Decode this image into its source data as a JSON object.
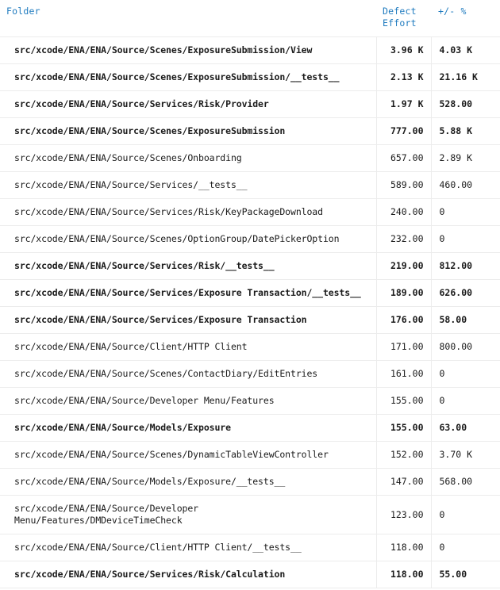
{
  "table": {
    "columns": {
      "folder": "Folder",
      "defect_effort": "Defect Effort",
      "defect_effort_line1": "Defect",
      "defect_effort_line2": "Effort",
      "delta_pct": "+/- %"
    },
    "header_color": "#1f7bbf",
    "row_border_color": "#ececec",
    "rows": [
      {
        "folder": "src/xcode/ENA/ENA/Source/Scenes/ExposureSubmission/View",
        "defect_effort": "3.96 K",
        "delta_pct": "4.03 K",
        "emphasis": "bold"
      },
      {
        "folder": "src/xcode/ENA/ENA/Source/Scenes/ExposureSubmission/__tests__",
        "defect_effort": "2.13 K",
        "delta_pct": "21.16 K",
        "emphasis": "bold"
      },
      {
        "folder": "src/xcode/ENA/ENA/Source/Services/Risk/Provider",
        "defect_effort": "1.97 K",
        "delta_pct": "528.00",
        "emphasis": "bold"
      },
      {
        "folder": "src/xcode/ENA/ENA/Source/Scenes/ExposureSubmission",
        "defect_effort": "777.00",
        "delta_pct": "5.88 K",
        "emphasis": "bold"
      },
      {
        "folder": "src/xcode/ENA/ENA/Source/Scenes/Onboarding",
        "defect_effort": "657.00",
        "delta_pct": "2.89 K",
        "emphasis": "normal"
      },
      {
        "folder": "src/xcode/ENA/ENA/Source/Services/__tests__",
        "defect_effort": "589.00",
        "delta_pct": "460.00",
        "emphasis": "normal"
      },
      {
        "folder": "src/xcode/ENA/ENA/Source/Services/Risk/KeyPackageDownload",
        "defect_effort": "240.00",
        "delta_pct": "0",
        "emphasis": "normal"
      },
      {
        "folder": "src/xcode/ENA/ENA/Source/Scenes/OptionGroup/DatePickerOption",
        "defect_effort": "232.00",
        "delta_pct": "0",
        "emphasis": "normal"
      },
      {
        "folder": "src/xcode/ENA/ENA/Source/Services/Risk/__tests__",
        "defect_effort": "219.00",
        "delta_pct": "812.00",
        "emphasis": "bold"
      },
      {
        "folder": "src/xcode/ENA/ENA/Source/Services/Exposure Transaction/__tests__",
        "defect_effort": "189.00",
        "delta_pct": "626.00",
        "emphasis": "bold"
      },
      {
        "folder": "src/xcode/ENA/ENA/Source/Services/Exposure Transaction",
        "defect_effort": "176.00",
        "delta_pct": "58.00",
        "emphasis": "bold"
      },
      {
        "folder": "src/xcode/ENA/ENA/Source/Client/HTTP Client",
        "defect_effort": "171.00",
        "delta_pct": "800.00",
        "emphasis": "normal"
      },
      {
        "folder": "src/xcode/ENA/ENA/Source/Scenes/ContactDiary/EditEntries",
        "defect_effort": "161.00",
        "delta_pct": "0",
        "emphasis": "normal"
      },
      {
        "folder": "src/xcode/ENA/ENA/Source/Developer Menu/Features",
        "defect_effort": "155.00",
        "delta_pct": "0",
        "emphasis": "normal"
      },
      {
        "folder": "src/xcode/ENA/ENA/Source/Models/Exposure",
        "defect_effort": "155.00",
        "delta_pct": "63.00",
        "emphasis": "bold"
      },
      {
        "folder": "src/xcode/ENA/ENA/Source/Scenes/DynamicTableViewController",
        "defect_effort": "152.00",
        "delta_pct": "3.70 K",
        "emphasis": "normal"
      },
      {
        "folder": "src/xcode/ENA/ENA/Source/Models/Exposure/__tests__",
        "defect_effort": "147.00",
        "delta_pct": "568.00",
        "emphasis": "normal"
      },
      {
        "folder": "src/xcode/ENA/ENA/Source/Developer Menu/Features/DMDeviceTimeCheck",
        "defect_effort": "123.00",
        "delta_pct": "0",
        "emphasis": "normal"
      },
      {
        "folder": "src/xcode/ENA/ENA/Source/Client/HTTP Client/__tests__",
        "defect_effort": "118.00",
        "delta_pct": "0",
        "emphasis": "normal"
      },
      {
        "folder": "src/xcode/ENA/ENA/Source/Services/Risk/Calculation",
        "defect_effort": "118.00",
        "delta_pct": "55.00",
        "emphasis": "bold"
      }
    ]
  }
}
